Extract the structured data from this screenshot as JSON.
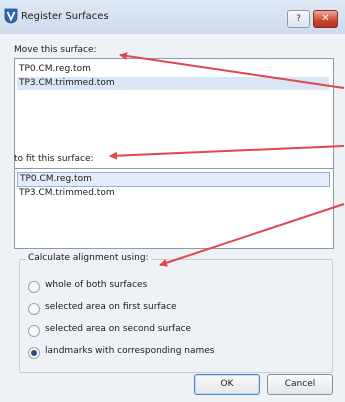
{
  "window": {
    "title": "Register Surfaces",
    "help_label": "?",
    "close_label": "✕"
  },
  "move": {
    "label": "Move this surface:",
    "items": [
      "TP0.CM.reg.tom",
      "TP3.CM.trimmed.tom"
    ],
    "selected_index": 1
  },
  "fit": {
    "label": "to fit this surface:",
    "items": [
      "TP0.CM.reg.tom",
      "TP3.CM.trimmed.tom"
    ],
    "selected_index": 0
  },
  "alignment": {
    "label": "Calculate alignment using:",
    "options": [
      "whole of both surfaces",
      "selected area on first surface",
      "selected area on second surface",
      "landmarks with corresponding names"
    ],
    "selected_index": 3
  },
  "buttons": {
    "ok": "OK",
    "cancel": "Cancel"
  },
  "annotation_color": "#e0474f"
}
